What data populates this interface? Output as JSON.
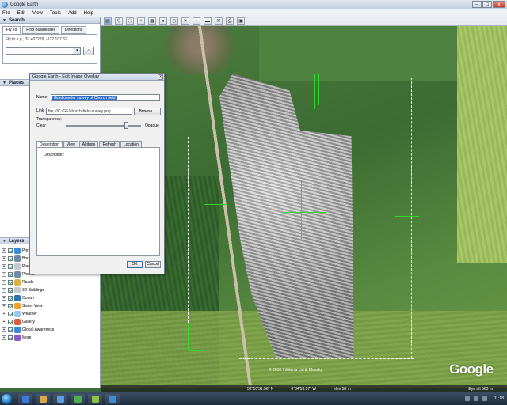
{
  "window": {
    "title": "Google Earth",
    "min": "–",
    "max": "□",
    "close": "x"
  },
  "menu": [
    "File",
    "Edit",
    "View",
    "Tools",
    "Add",
    "Help"
  ],
  "toolbar": {
    "icons": [
      "sidebar-icon",
      "placemark-icon",
      "polygon-icon",
      "path-icon",
      "image-overlay-icon",
      "tour-icon",
      "history-icon",
      "sun-icon",
      "planets-icon",
      "ruler-icon",
      "email-icon",
      "print-icon",
      "maps-icon"
    ]
  },
  "search": {
    "header": "Search",
    "tabs": [
      "Fly To",
      "Find Businesses",
      "Directions"
    ],
    "hint": "Fly to e.g., 37.407229, -122.107.62",
    "button_icon": "⌕"
  },
  "places": {
    "header": "Places"
  },
  "layers": {
    "header": "Layers",
    "items": [
      {
        "label": "Primary Database",
        "checked": true,
        "icon": "lc-globe"
      },
      {
        "label": "Borders and Labels",
        "checked": true,
        "icon": "lc-photo"
      },
      {
        "label": "Places",
        "checked": true,
        "icon": "lc-bld"
      },
      {
        "label": "Photos",
        "checked": true,
        "icon": "lc-photo"
      },
      {
        "label": "Roads",
        "checked": true,
        "icon": "lc-road"
      },
      {
        "label": "3D Buildings",
        "checked": true,
        "icon": "lc-bld"
      },
      {
        "label": "Ocean",
        "checked": true,
        "icon": "lc-ocean"
      },
      {
        "label": "Street View",
        "checked": true,
        "icon": "lc-street"
      },
      {
        "label": "Weather",
        "checked": true,
        "icon": "lc-weather"
      },
      {
        "label": "Gallery",
        "checked": true,
        "icon": "lc-gallery"
      },
      {
        "label": "Global Awareness",
        "checked": true,
        "icon": "lc-globe"
      },
      {
        "label": "More",
        "checked": true,
        "icon": "lc-more"
      }
    ]
  },
  "dialog": {
    "title": "Google Earth - Edit Image Overlay",
    "close": "x",
    "name_label": "Name:",
    "name_value": "Gradiometer survey of Church field",
    "link_label": "Link:",
    "link_value": "file:///C:/GE/church-field-survey.png",
    "browse": "Browse...",
    "transparency_label": "Transparency:",
    "clear_label": "Clear",
    "opaque_label": "Opaque",
    "transparency_value": 0.8,
    "tabs": [
      "Description",
      "View",
      "Altitude",
      "Refresh",
      "Location"
    ],
    "description_label": "Description:",
    "ok": "OK",
    "cancel": "Cancel"
  },
  "map": {
    "copyright": "© 2010 Infoterra Ltd & Bluesky",
    "logo": "Google",
    "status": [
      "52°10'31.56\" N",
      "0°34'53.97\" W",
      "elev  58 m",
      "Eye alt  563 m"
    ]
  },
  "taskbar": {
    "apps": [
      "#3a7bd5",
      "#d9a84a",
      "#5aa0e0",
      "#4caf50",
      "#8bc34a",
      "#3d8bd8"
    ],
    "clock": "11:18"
  }
}
